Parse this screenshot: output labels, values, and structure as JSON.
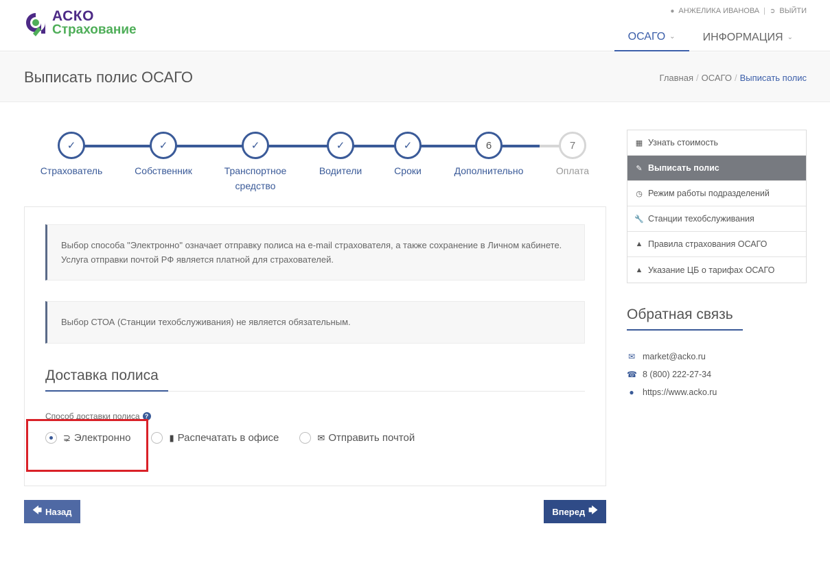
{
  "header": {
    "logo_line1": "АСКО",
    "logo_line2": "Страхование",
    "user_name": "АНЖЕЛИКА ИВАНОВА",
    "logout_label": "ВЫЙТИ",
    "nav": [
      {
        "label": "ОСАГО",
        "active": true
      },
      {
        "label": "ИНФОРМАЦИЯ",
        "active": false
      }
    ]
  },
  "titlebar": {
    "title": "Выписать полис ОСАГО",
    "breadcrumb": [
      "Главная",
      "ОСАГО",
      "Выписать полис"
    ]
  },
  "stepper": {
    "steps": [
      {
        "label_line1": "Страхователь",
        "label_line2": "",
        "state": "done"
      },
      {
        "label_line1": "Собственник",
        "label_line2": "",
        "state": "done"
      },
      {
        "label_line1": "Транспортное",
        "label_line2": "средство",
        "state": "done"
      },
      {
        "label_line1": "Водители",
        "label_line2": "",
        "state": "done"
      },
      {
        "label_line1": "Сроки",
        "label_line2": "",
        "state": "done"
      },
      {
        "label_line1": "Дополнительно",
        "label_line2": "",
        "number": "6",
        "state": "current"
      },
      {
        "label_line1": "Оплата",
        "label_line2": "",
        "number": "7",
        "state": "pending"
      }
    ]
  },
  "main": {
    "note1": "Выбор способа \"Электронно\" означает отправку полиса на e-mail страхователя, а также сохранение в Личном кабинете. Услуга отправки почтой РФ является платной для страхователей.",
    "note2": "Выбор СТОА (Станции техобслуживания) не является обязательным.",
    "section_title": "Доставка полиса",
    "delivery_label": "Способ доставки полиса",
    "delivery_options": [
      {
        "label": "Электронно",
        "icon": "rss-icon",
        "checked": true
      },
      {
        "label": "Распечатать в офисе",
        "icon": "tablet-icon",
        "checked": false
      },
      {
        "label": "Отправить почтой",
        "icon": "envelope-icon",
        "checked": false
      }
    ],
    "back_label": "Назад",
    "next_label": "Вперед"
  },
  "sidebar": {
    "menu": [
      {
        "label": "Узнать стоимость",
        "icon": "calculator-icon",
        "active": false
      },
      {
        "label": "Выписать полис",
        "icon": "edit-icon",
        "active": true
      },
      {
        "label": "Режим работы подразделений",
        "icon": "clock-icon",
        "active": false
      },
      {
        "label": "Станции техобслуживания",
        "icon": "wrench-icon",
        "active": false
      },
      {
        "label": "Правила страхования ОСАГО",
        "icon": "graduation-cap-icon",
        "active": false
      },
      {
        "label": "Указание ЦБ о тарифах ОСАГО",
        "icon": "graduation-cap-icon",
        "active": false
      }
    ],
    "feedback_title": "Обратная связь",
    "contacts": [
      {
        "text": "market@acko.ru",
        "icon": "envelope-icon"
      },
      {
        "text": "8 (800) 222-27-34",
        "icon": "phone-icon"
      },
      {
        "text": "https://www.acko.ru",
        "icon": "globe-icon"
      }
    ]
  },
  "colors": {
    "accent": "#3a5a98",
    "logo_purple": "#4d2a86",
    "logo_green": "#4fae59",
    "highlight_red": "#d92128"
  }
}
